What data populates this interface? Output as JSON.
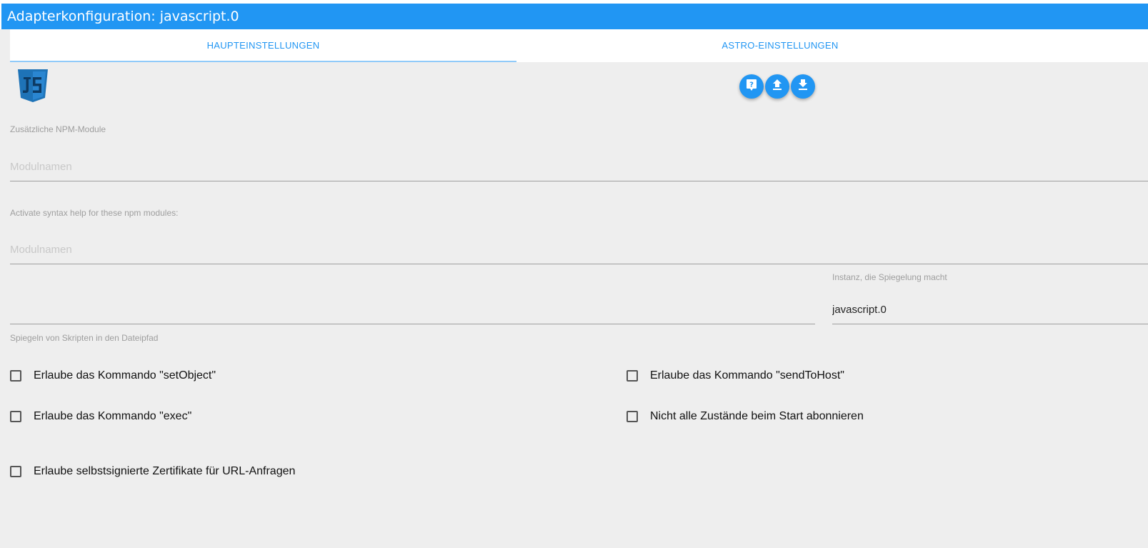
{
  "window": {
    "title": "Adapterkonfiguration: javascript.0"
  },
  "tabs": [
    {
      "label": "HAUPTEINSTELLUNGEN",
      "active": true
    },
    {
      "label": "ASTRO-EINSTELLUNGEN",
      "active": false
    }
  ],
  "toolbar": {
    "help_icon": "help-icon",
    "upload_icon": "upload-icon",
    "download_icon": "download-icon"
  },
  "logo": {
    "icon": "javascript-logo-icon",
    "color": "#1e73b7"
  },
  "fields": {
    "npm_modules": {
      "label": "Zusätzliche NPM-Module",
      "placeholder": "Modulnamen",
      "value": ""
    },
    "syntax_help_modules": {
      "label": "Activate syntax help for these npm modules:",
      "placeholder": "Modulnamen",
      "value": ""
    },
    "mirror_path": {
      "helper": "Spiegeln von Skripten in den Dateipfad",
      "value": ""
    },
    "mirror_instance": {
      "label": "Instanz, die Spiegelung macht",
      "value": "javascript.0"
    }
  },
  "checkboxes": {
    "set_object": {
      "label": "Erlaube das Kommando \"setObject\"",
      "checked": false
    },
    "send_to_host": {
      "label": "Erlaube das Kommando \"sendToHost\"",
      "checked": false
    },
    "exec": {
      "label": "Erlaube das Kommando \"exec\"",
      "checked": false
    },
    "no_subscribe": {
      "label": "Nicht alle Zustände beim Start abonnieren",
      "checked": false
    },
    "self_signed": {
      "label": "Erlaube selbstsignierte Zertifikate für URL-Anfragen",
      "checked": false
    }
  },
  "colors": {
    "accent": "#2196f3",
    "background": "#eeeeee",
    "label_gray": "#9e9e9e"
  }
}
